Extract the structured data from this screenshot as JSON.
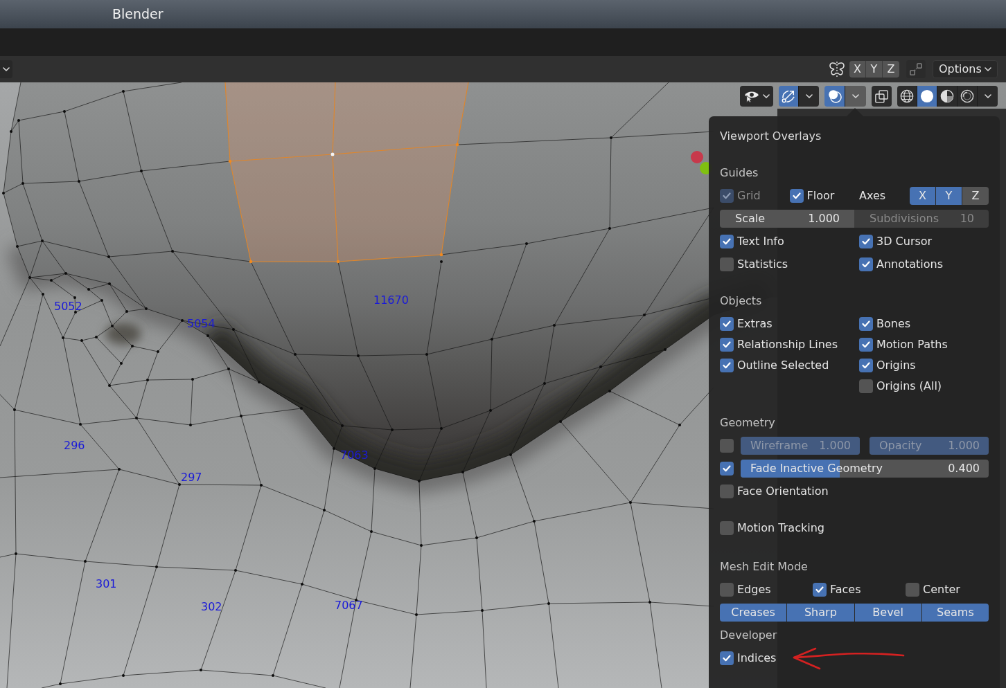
{
  "window": {
    "title": "Blender"
  },
  "header": {
    "mirror_axes": [
      {
        "label": "X",
        "selected": false
      },
      {
        "label": "Y",
        "selected": false
      },
      {
        "label": "Z",
        "selected": false
      }
    ],
    "options": "Options"
  },
  "viewport": {
    "index_labels": [
      "5052",
      "5054",
      "11670",
      "296",
      "297",
      "7063",
      "301",
      "302",
      "7067"
    ],
    "toolbar": {
      "gizmos": {
        "on": true
      },
      "overlays": {
        "on": true,
        "menu_open": true
      },
      "xray": {
        "on": false
      },
      "shading": [
        {
          "kind": "wireframe",
          "selected": false
        },
        {
          "kind": "solid",
          "selected": true
        },
        {
          "kind": "material",
          "selected": false
        },
        {
          "kind": "rendered",
          "selected": false
        }
      ]
    }
  },
  "overlays": {
    "title": "Viewport Overlays",
    "sections": [
      {
        "heading": "Guides",
        "rows": [
          {
            "kind": "halves",
            "left": [
              {
                "kind": "check",
                "label": "Grid",
                "checked": true,
                "disabled": true
              },
              {
                "kind": "check",
                "label": "Floor",
                "checked": true,
                "disabled": false
              }
            ],
            "right": [
              {
                "kind": "axes",
                "label": "Axes",
                "buttons": [
                  {
                    "label": "X",
                    "selected": true
                  },
                  {
                    "label": "Y",
                    "selected": true
                  },
                  {
                    "label": "Z",
                    "selected": false
                  }
                ]
              }
            ]
          },
          {
            "kind": "fields",
            "fields": [
              {
                "label": "Scale",
                "value": "1.000",
                "disabled": false
              },
              {
                "label": "Subdivisions",
                "value": "10",
                "disabled": true
              }
            ]
          },
          {
            "kind": "halves",
            "left": [
              {
                "kind": "check",
                "label": "Text Info",
                "checked": true
              }
            ],
            "right": [
              {
                "kind": "check",
                "label": "3D Cursor",
                "checked": true
              }
            ]
          },
          {
            "kind": "halves",
            "left": [
              {
                "kind": "check",
                "label": "Statistics",
                "checked": false
              }
            ],
            "right": [
              {
                "kind": "check",
                "label": "Annotations",
                "checked": true
              }
            ]
          }
        ]
      },
      {
        "heading": "Objects",
        "rows": [
          {
            "kind": "columns",
            "columns": [
              [
                {
                  "label": "Extras",
                  "checked": true
                },
                {
                  "label": "Relationship Lines",
                  "checked": true
                },
                {
                  "label": "Outline Selected",
                  "checked": true
                }
              ],
              [
                {
                  "label": "Bones",
                  "checked": true
                },
                {
                  "label": "Motion Paths",
                  "checked": true
                },
                {
                  "label": "Origins",
                  "checked": true
                },
                {
                  "label": "Origins (All)",
                  "checked": false
                }
              ]
            ]
          }
        ]
      },
      {
        "heading": "Geometry",
        "rows": [
          {
            "kind": "sliders",
            "checked": false,
            "sliders": [
              {
                "label": "Wireframe",
                "value": "1.000",
                "level": 1,
                "disabled": true
              },
              {
                "label": "Opacity",
                "value": "1.000",
                "level": 1,
                "disabled": true
              }
            ]
          },
          {
            "kind": "sliders",
            "checked": true,
            "sliders": [
              {
                "label": "Fade Inactive Geometry",
                "value": "0.400",
                "level": 0.4,
                "disabled": false
              }
            ]
          },
          {
            "kind": "check",
            "label": "Face Orientation",
            "checked": false
          }
        ]
      },
      {
        "header_check": {
          "label": "Motion Tracking",
          "checked": false
        }
      },
      {
        "heading": "Mesh Edit Mode",
        "rows": [
          {
            "kind": "thirds",
            "items": [
              {
                "label": "Edges",
                "checked": false
              },
              {
                "label": "Faces",
                "checked": true
              },
              {
                "label": "Center",
                "checked": false
              }
            ]
          },
          {
            "kind": "toggles",
            "buttons": [
              {
                "label": "Creases",
                "selected": true
              },
              {
                "label": "Sharp",
                "selected": true
              },
              {
                "label": "Bevel",
                "selected": true
              },
              {
                "label": "Seams",
                "selected": true
              }
            ]
          },
          {
            "kind": "label",
            "text": "Developer"
          },
          {
            "kind": "check",
            "label": "Indices",
            "checked": true
          }
        ]
      }
    ]
  }
}
